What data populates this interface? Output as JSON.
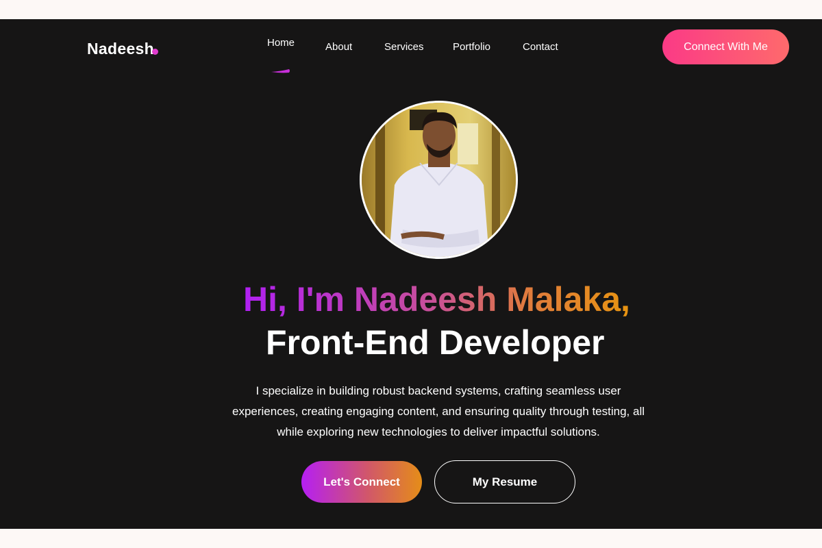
{
  "brand": {
    "logo_text": "Nadeesh",
    "accent_color": "#df3bcd"
  },
  "nav": {
    "items": [
      {
        "label": "Home",
        "active": true
      },
      {
        "label": "About",
        "active": false
      },
      {
        "label": "Services",
        "active": false
      },
      {
        "label": "Portfolio",
        "active": false
      },
      {
        "label": "Contact",
        "active": false
      }
    ],
    "cta_label": "Connect With Me",
    "cta_gradient": [
      "#fb3a86",
      "#fe6a6c"
    ]
  },
  "hero": {
    "avatar_alt": "profile-photo",
    "greeting": "Hi, I'm Nadeesh Malaka,",
    "role": "Front-End Developer",
    "description_lines": [
      "I specialize in building robust backend systems, crafting seamless user",
      "experiences, creating engaging content, and ensuring quality through testing, all",
      "while exploring new technologies to deliver impactful solutions."
    ],
    "primary_button": "Let's Connect",
    "secondary_button": "My Resume",
    "gradient_colors": [
      "#b020f2",
      "#c84f9a",
      "#e07a3f",
      "#e8950f"
    ]
  },
  "colors": {
    "background": "#161515",
    "page_margin": "#fdf8f6",
    "text": "#ffffff"
  }
}
